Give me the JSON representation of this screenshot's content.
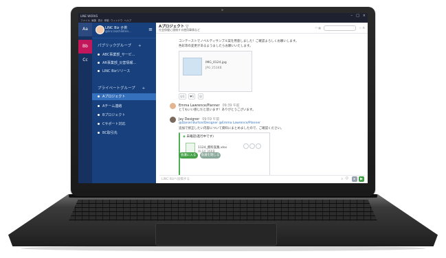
{
  "app": {
    "window_title": "LINE WORKS",
    "menu": [
      "ファイル",
      "編集",
      "表示",
      "移動",
      "ウィンドウ",
      "ヘルプ"
    ],
    "window_controls": {
      "min": "–",
      "max": "□",
      "close": "×"
    }
  },
  "workspaces": [
    {
      "label": "Aa"
    },
    {
      "label": "Bb"
    },
    {
      "label": "Cc"
    }
  ],
  "sidebar": {
    "user_name": "LINC Biz 子供",
    "user_id": "@linc.bizchildren...",
    "public_section": "パブリックグループ",
    "public_channels": [
      "ABC事業部_サービ...",
      "AR事業部_災害情報...",
      "LINC Bizリリース"
    ],
    "private_section": "プライベートグループ",
    "private_channels": [
      "Aプロジェクト",
      "Aチーム連絡",
      "Bプロジェクト",
      "Cサポート対応",
      "BC取引先"
    ],
    "add": "+"
  },
  "main": {
    "channel_title": "Aプロジェクト ▽",
    "channel_subtitle": "社会保健に連絡する使用事情など",
    "message1": {
      "line1": "コンテーストでノベルティサンプル案を用意しました！ご確認よろしくお願いします。",
      "line2": "色彩等の変更があるようましたらお願いいたします。",
      "file_name": "IMG_0124.jpg",
      "file_size": "JPG 251KB",
      "reactions": [
        "1",
        "1",
        "☺"
      ]
    },
    "message2": {
      "author": "Emma Lawrence/Planner",
      "time": "09:39 午前",
      "text": "とてもいい感じだと思います！ありがとうございます。"
    },
    "message3": {
      "author": "Jay Designer",
      "time": "09:59 午前",
      "mention": "@Daniel Burton/Designer   @Emma Lawrence/Planner",
      "text": "追加で修正したい内容について資料にまとめましたので、ご確認ください。"
    },
    "task": {
      "status": "未確認(進行中です)",
      "file_name": "1124_資料案集.xlsx",
      "file_size": "XLSX 36KB",
      "btn_enter": "会議に入る",
      "btn_more": "会議を閉じる"
    },
    "composer_placeholder": "LINC Bizへ投稿する"
  },
  "colors": {
    "rail": "#16305f",
    "sidebar": "#17407c",
    "active_channel": "#3570bd",
    "accent_green": "#4caf50"
  }
}
